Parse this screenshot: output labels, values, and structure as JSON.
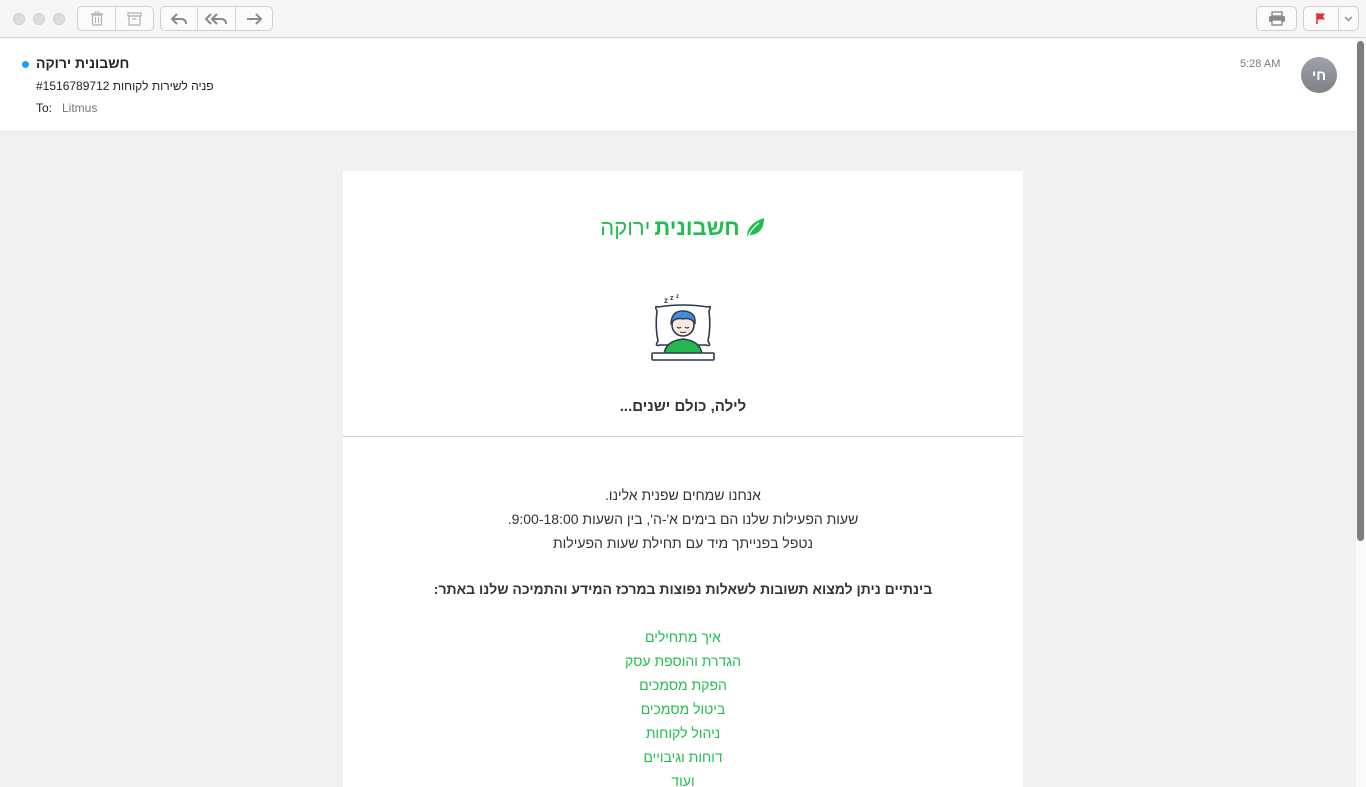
{
  "toolbar": {
    "buttons": [
      "trash-icon",
      "archive-icon",
      "reply-icon",
      "reply-all-icon",
      "forward-icon",
      "print-icon",
      "flag-icon",
      "chevron-down-icon"
    ],
    "flag_color": "#e8312a"
  },
  "header": {
    "sender": "חשבונית ירוקה",
    "subject": "פניה לשירות לקוחות #1516789712",
    "to_label": "To:",
    "to_value": "Litmus",
    "time": "5:28 AM",
    "avatar_initials": "חי",
    "unread_color": "#1e9bf0"
  },
  "email": {
    "logo_bold": "חשבונית",
    "logo_light": "ירוקה",
    "brand_color": "#1fbd4e",
    "night_title": "לילה, כולם ישנים...",
    "lines": [
      "אנחנו שמחים שפנית אלינו.",
      "שעות הפעילות שלנו הם בימים א'-ה', בין השעות 9:00-18:00.",
      "נטפל בפנייתך מיד עם תחילת שעות הפעילות"
    ],
    "faq_heading": "בינתיים ניתן למצוא תשובות לשאלות נפוצות במרכז המידע והתמיכה שלנו באתר:",
    "links": [
      "איך מתחילים",
      "הגדרת והוספת עסק",
      "הפקת מסמכים",
      "ביטול מסמכים",
      "ניהול לקוחות",
      "דוחות וגיבויים",
      "ועוד"
    ]
  }
}
